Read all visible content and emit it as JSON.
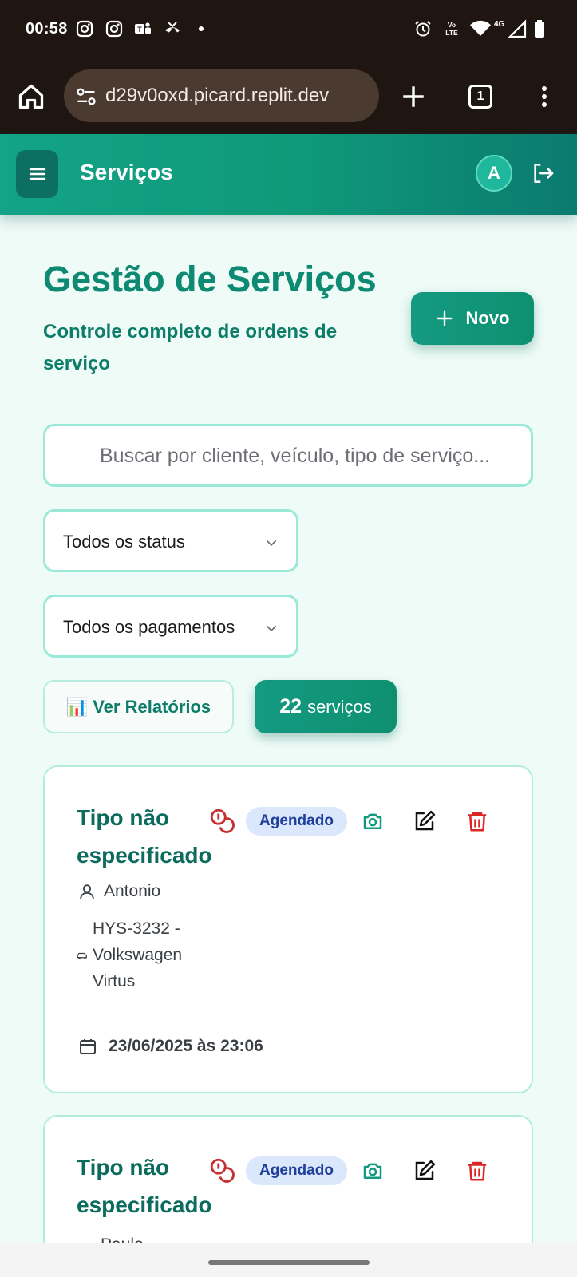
{
  "status_bar": {
    "time": "00:58",
    "icons": [
      "instagram-icon",
      "instagram-icon",
      "teams-icon",
      "missed-call-icon",
      "dot-icon",
      "alarm-icon",
      "volte-icon",
      "wifi-icon",
      "signal-4g-icon",
      "battery-icon"
    ],
    "network": "4G"
  },
  "browser": {
    "url": "d29v0oxd.picard.replit.dev",
    "tab_count": "1"
  },
  "header": {
    "title": "Serviços",
    "avatar_initial": "A"
  },
  "page": {
    "title": "Gestão de Serviços",
    "subtitle": "Controle completo de ordens de serviço",
    "new_button_label": "Novo"
  },
  "search": {
    "placeholder": "Buscar por cliente, veículo, tipo de serviço...",
    "value": ""
  },
  "filters": {
    "status_selected": "Todos os status",
    "payment_selected": "Todos os pagamentos"
  },
  "reports_button": {
    "emoji": "📊",
    "label": "Ver Relatórios"
  },
  "service_count": {
    "number": "22",
    "label": "serviços"
  },
  "colors": {
    "primary": "#0f9a7a",
    "header_gradient_end": "#0b7a70",
    "badge_bg": "#dbe7fb",
    "badge_text": "#1f3f9c",
    "delete_red": "#dc2626",
    "cost_red": "#c53030"
  },
  "services": [
    {
      "title": "Tipo não especificado",
      "status": "Agendado",
      "client": "Antonio",
      "vehicle": "HYS-3232 - Volkswagen Virtus",
      "datetime": "23/06/2025 às 23:06"
    },
    {
      "title": "Tipo não especificado",
      "status": "Agendado",
      "client": "Paulo",
      "vehicle": "",
      "datetime": ""
    }
  ]
}
